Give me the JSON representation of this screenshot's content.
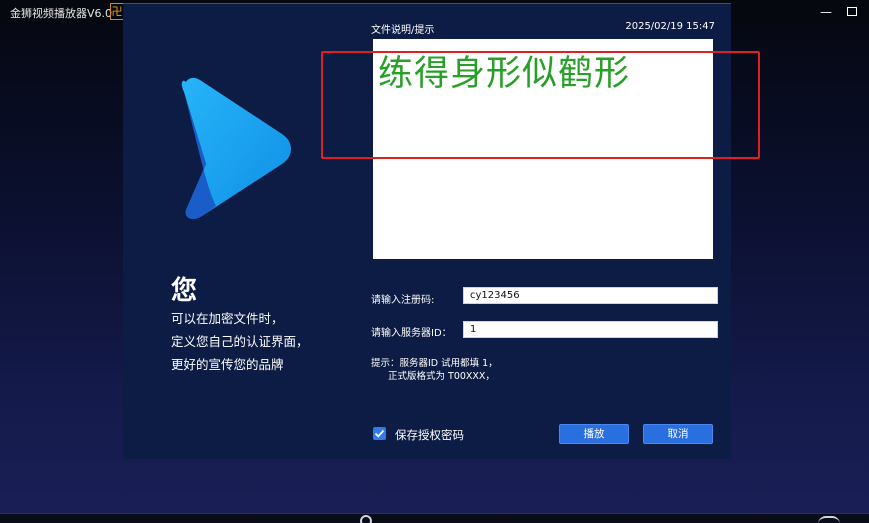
{
  "app": {
    "title": "金狮视频播放器V6.0",
    "logo_glyph": "卍",
    "window_minimize_icon": "minus-icon",
    "window_maximize_icon": "maximize-icon"
  },
  "dialog": {
    "description_label": "文件说明/提示",
    "datetime": "2025/02/19 15:47",
    "description_text": "练得身形似鹤形",
    "promo": {
      "title": "您",
      "line1": "可以在加密文件时，",
      "line2": "定义您自己的认证界面，",
      "line3": "更好的宣传您的品牌"
    },
    "registration": {
      "label": "请输入注册码:",
      "value": "cy123456"
    },
    "server_id": {
      "label": "请输入服务器ID：",
      "value": "1"
    },
    "hint_line1": "提示：服务器ID 试用都填 1，",
    "hint_line2": "正式版格式为 T00XXX，",
    "save_password": {
      "label": "保存授权密码",
      "checked": true
    },
    "buttons": {
      "play": "播放",
      "cancel": "取消"
    }
  },
  "colors": {
    "dialog_bg": "#0d1c44",
    "accent_blue": "#2a6fe0",
    "logo_blue": "#1ea0f0",
    "text_green": "#28a028",
    "annotation_red": "#e02020"
  }
}
